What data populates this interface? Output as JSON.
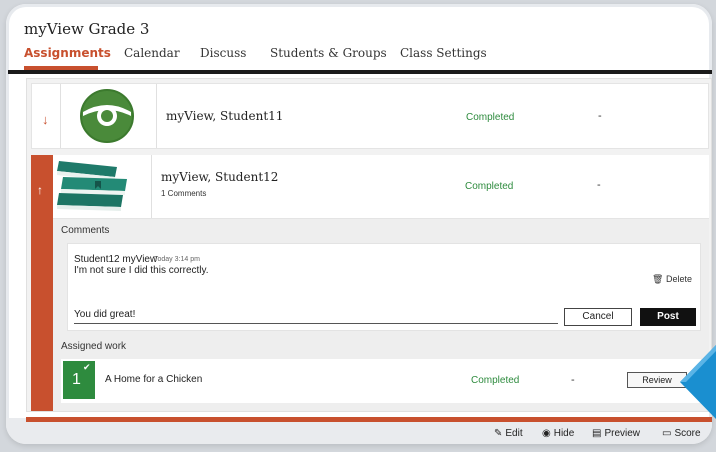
{
  "app": {
    "title": "myView Grade 3"
  },
  "nav": {
    "tabs": [
      {
        "label": "Assignments",
        "active": true
      },
      {
        "label": "Calendar"
      },
      {
        "label": "Discuss"
      },
      {
        "label": "Students & Groups"
      },
      {
        "label": "Class Settings"
      }
    ]
  },
  "students": [
    {
      "name": "myView, Student11",
      "status": "Completed",
      "score": "-",
      "avatar": "disc-avatar-icon",
      "expanded": false
    },
    {
      "name": "myView, Student12",
      "comments_count": "1 Comments",
      "status": "Completed",
      "score": "-",
      "avatar": "books-avatar-icon",
      "expanded": true
    }
  ],
  "comments": {
    "heading": "Comments",
    "author": "Student12 myView",
    "time": "Today 3:14 pm",
    "text": "I'm not sure I did this correctly.",
    "delete_label": "Delete",
    "reply_value": "You did great!",
    "cancel_label": "Cancel",
    "post_label": "Post"
  },
  "assigned_work": {
    "heading": "Assigned work",
    "items": [
      {
        "number": "1",
        "title": "A Home for a Chicken",
        "status": "Completed",
        "score": "-",
        "review_label": "Review"
      }
    ]
  },
  "actions": {
    "edit": "Edit",
    "hide": "Hide",
    "preview": "Preview",
    "score": "Score"
  },
  "colors": {
    "accent": "#c8502e",
    "completed": "#2e8b3e",
    "pointer": "#1a8fd0"
  }
}
